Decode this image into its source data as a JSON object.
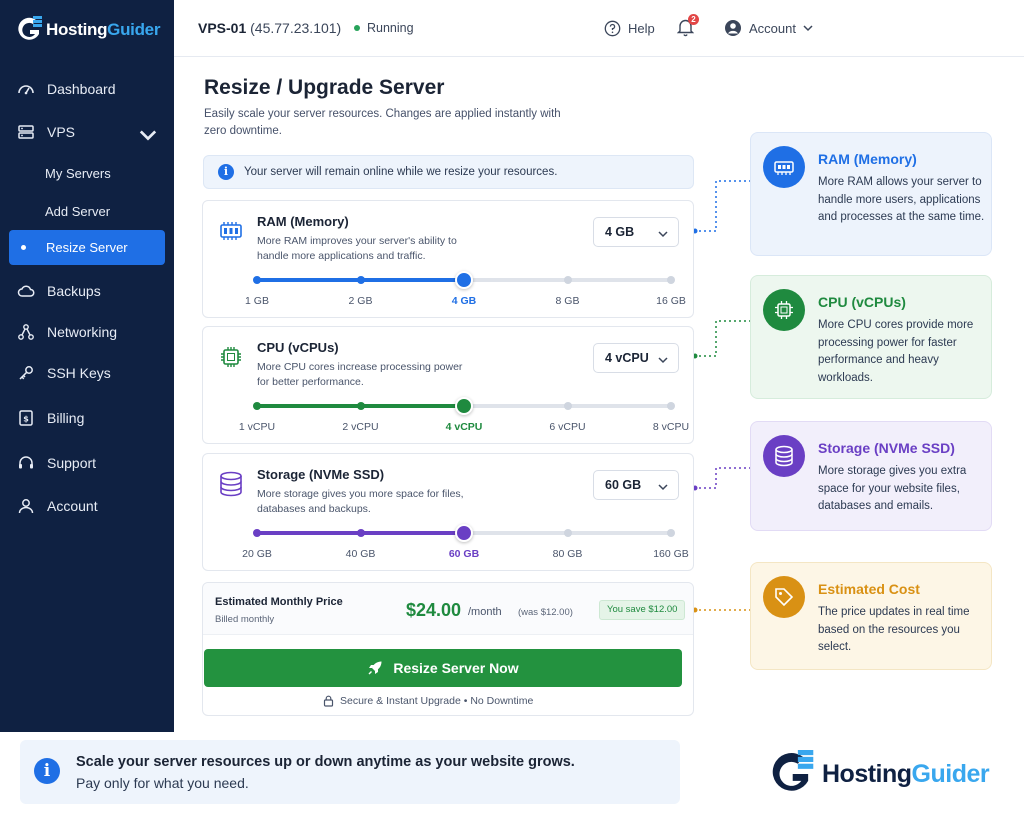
{
  "brand": {
    "name_part1": "Hosting",
    "name_part2": "Guider"
  },
  "sidebar": {
    "items": [
      {
        "label": "Dashboard",
        "icon": "gauge-icon"
      },
      {
        "label": "VPS",
        "icon": "server-icon"
      },
      {
        "label": "My Servers"
      },
      {
        "label": "Add Server"
      },
      {
        "label": "Resize Server",
        "active": true
      },
      {
        "label": "Backups",
        "icon": "cloud-icon"
      },
      {
        "label": "Networking",
        "icon": "network-icon"
      },
      {
        "label": "SSH Keys",
        "icon": "key-icon"
      },
      {
        "label": "Billing",
        "icon": "invoice-icon"
      },
      {
        "label": "Support",
        "icon": "headset-icon"
      },
      {
        "label": "Account",
        "icon": "user-icon"
      }
    ]
  },
  "topbar": {
    "server_name": "VPS-01",
    "server_ip": "(45.77.23.101)",
    "status": "Running",
    "help": "Help",
    "notifications": "2",
    "account": "Account"
  },
  "main": {
    "title": "Resize / Upgrade Server",
    "subtitle": "Easily scale your server resources. Changes are applied instantly with zero downtime.",
    "notice": "Your server will remain online while we resize your resources."
  },
  "resources": {
    "ram": {
      "title": "RAM (Memory)",
      "desc": "More RAM improves your server's ability to handle more applications and traffic.",
      "selected": "4 GB",
      "options": [
        "1 GB",
        "2 GB",
        "4 GB",
        "8 GB",
        "16 GB"
      ],
      "selected_index": 2,
      "color": "#1f6fe5"
    },
    "cpu": {
      "title": "CPU (vCPUs)",
      "desc": "More CPU cores increase processing power for better performance.",
      "selected": "4 vCPU",
      "options": [
        "1 vCPU",
        "2 vCPU",
        "4 vCPU",
        "6 vCPU",
        "8 vCPU"
      ],
      "selected_index": 2,
      "color": "#1f8a3f"
    },
    "storage": {
      "title": "Storage (NVMe SSD)",
      "desc": "More storage gives you more space for files, databases and backups.",
      "selected": "60 GB",
      "options": [
        "20 GB",
        "40 GB",
        "60 GB",
        "80 GB",
        "160 GB"
      ],
      "selected_index": 2,
      "color": "#6a3fc4"
    }
  },
  "pricing": {
    "label": "Estimated Monthly Price",
    "billed": "Billed monthly",
    "amount": "$24.00",
    "unit": "/month",
    "was": "(was $12.00)",
    "savings": "You save $12.00",
    "button": "Resize Server Now",
    "footnote": "Secure & Instant Upgrade  •  No Downtime"
  },
  "info_cards": [
    {
      "title": "RAM (Memory)",
      "text": "More RAM allows your server to handle more users, applications and processes at the same time.",
      "accent": "#1f6fe5",
      "bg": "#edf3fc"
    },
    {
      "title": "CPU (vCPUs)",
      "text": "More CPU cores provide more processing power for faster performance and heavy workloads.",
      "accent": "#1f8a3f",
      "bg": "#edf7ef"
    },
    {
      "title": "Storage (NVMe SSD)",
      "text": "More storage gives you extra space for your website files, databases and emails.",
      "accent": "#6a3fc4",
      "bg": "#f2effb"
    },
    {
      "title": "Estimated Cost",
      "text": "The price updates in real time based on the resources you select.",
      "accent": "#d99114",
      "bg": "#fdf6e6"
    }
  ],
  "banner": {
    "line1": "Scale your server resources up or down anytime as your website grows.",
    "line2": "Pay only for what you need."
  }
}
